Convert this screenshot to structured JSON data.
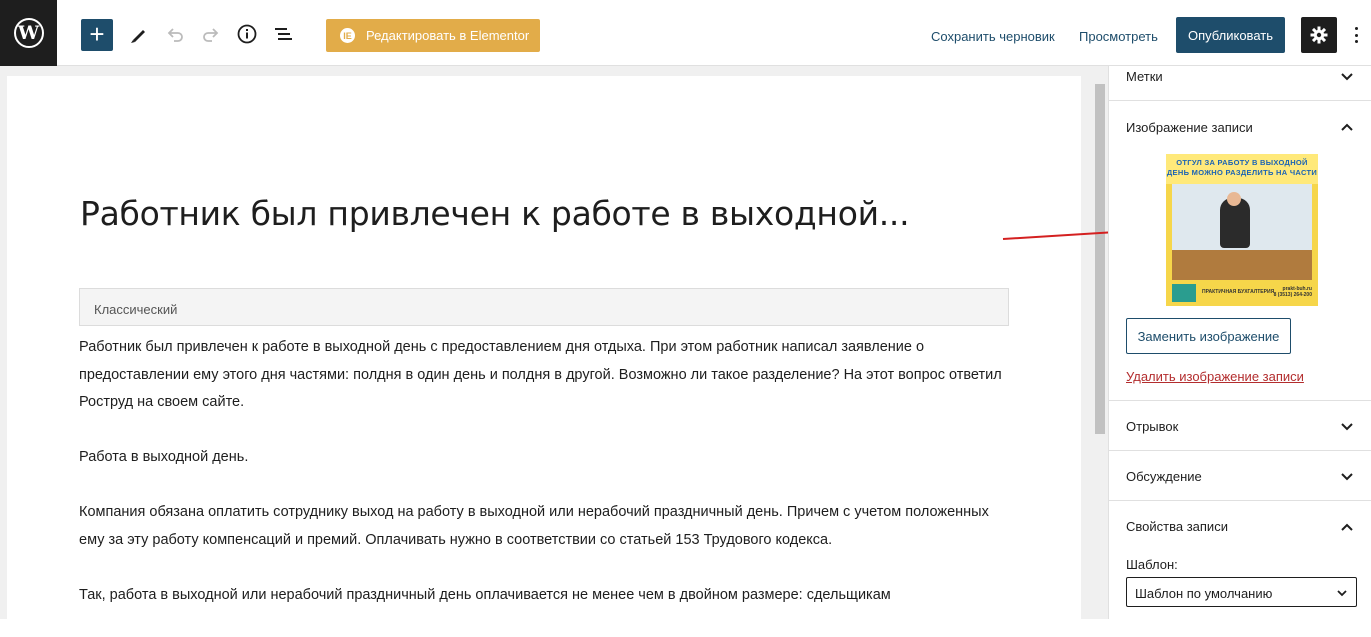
{
  "toolbar": {
    "elementor_label": "Редактировать в Elementor",
    "elementor_icon": "IE",
    "save_draft": "Сохранить черновик",
    "preview": "Просмотреть",
    "publish": "Опубликовать",
    "wp_logo": "W"
  },
  "editor": {
    "title": "Работник был привлечен к работе в выходной...",
    "classic_block_label": "Классический",
    "paragraphs": [
      "Работник был привлечен к работе в выходной день с предоставлением дня отдыха. При этом работник написал заявление о предоставлении ему этого дня частями: полдня в один день и полдня в другой. Возможно ли такое разделение? На этот вопрос ответил Роструд на своем сайте.",
      "Работа в выходной день.",
      "Компания обязана оплатить сотруднику выход на работу в выходной или нерабочий праздничный день. Причем с учетом положенных ему за эту работу компенсаций и премий. Оплачивать нужно в соответствии со статьей 153 Трудового кодекса.",
      "Так, работа в выходной или нерабочий праздничный день оплачивается не менее чем в двойном размере: сдельщикам"
    ]
  },
  "sidebar": {
    "tags_title": "Метки",
    "featured_title": "Изображение записи",
    "featured_image": {
      "headline": "ОТГУЛ ЗА РАБОТУ В ВЫХОДНОЙ ДЕНЬ МОЖНО РАЗДЕЛИТЬ НА ЧАСТИ",
      "brand": "ПРАКТИЧНАЯ БУХГАЛТЕРИЯ",
      "site": "prakt-buh.ru",
      "phone": "8 (3513) 264-200"
    },
    "replace_button": "Заменить изображение",
    "remove_link": "Удалить изображение записи",
    "excerpt_title": "Отрывок",
    "discussion_title": "Обсуждение",
    "properties_title": "Свойства записи",
    "template_label": "Шаблон:",
    "template_value": "Шаблон по умолчанию"
  },
  "colors": {
    "primary": "#1e4d6b",
    "elementor": "#e2ac49",
    "danger": "#b32d2e",
    "arrow": "#d42020"
  }
}
